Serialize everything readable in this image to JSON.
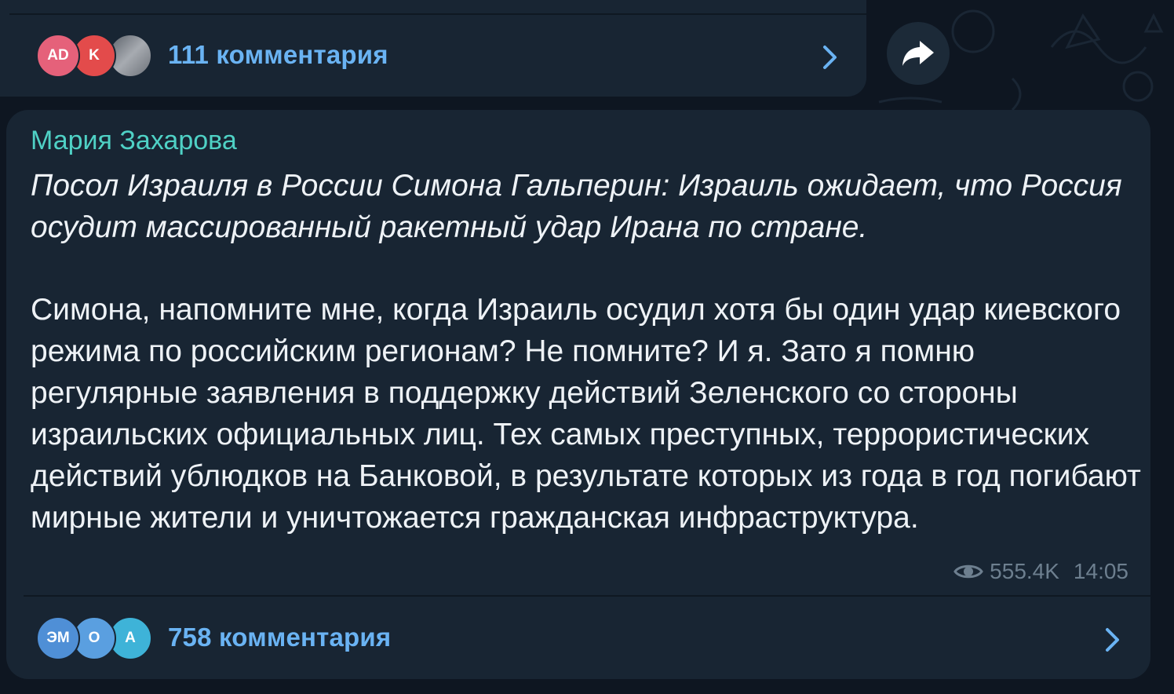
{
  "previous_post": {
    "comments_label": "111 комментария",
    "avatars": [
      {
        "initials": "AD",
        "color": "#e5617a"
      },
      {
        "initials": "K",
        "color": "#e34b4b"
      },
      {
        "initials": "",
        "color": "#8a8f96"
      }
    ]
  },
  "post": {
    "author": "Мария Захарова",
    "quote": "Посол Израиля в России Симона Гальперин: Израиль ожидает, что Россия осудит массированный ракетный удар Ирана по стране.",
    "body": "Симона, напомните мне, когда Израиль осудил хотя бы один удар киевского режима по российским регионам? Не помните? И я. Зато я помню регулярные заявления в поддержку действий Зеленского со стороны израильских официальных лиц.  Тех самых преступных, террористических действий ублюдков на Банковой, в результате которых из года в год погибают мирные жители и уничтожается гражданская инфраструктура.",
    "views": "555.4K",
    "time": "14:05",
    "comments_label": "758 комментария",
    "avatars": [
      {
        "initials": "ЭМ",
        "color": "#4f8fd6"
      },
      {
        "initials": "О",
        "color": "#5a9fe0"
      },
      {
        "initials": "А",
        "color": "#3eb3d8"
      }
    ]
  },
  "colors": {
    "background": "#0e1621",
    "bubble": "#182533",
    "accent_link": "#6ab3f3",
    "author": "#4fd1c5"
  },
  "icons": [
    "chevron-right-icon",
    "share-icon",
    "eye-icon"
  ]
}
